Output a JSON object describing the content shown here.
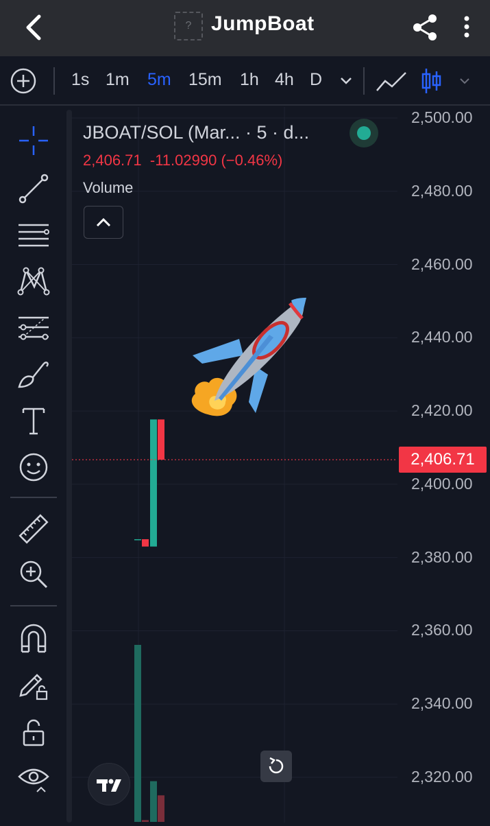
{
  "header": {
    "title": "JumpBoat",
    "image_placeholder": "?"
  },
  "toolbar": {
    "intervals": [
      "1s",
      "1m",
      "5m",
      "15m",
      "1h",
      "4h",
      "D"
    ],
    "active_interval": "5m"
  },
  "legend": {
    "symbol": "JBOAT/SOL (Mar...  · 5 · d...",
    "last": "2,406.71",
    "change": "-11.02990",
    "change_pct": "(−0.46%)",
    "volume_label": "Volume"
  },
  "price_axis": {
    "labels": [
      "2,500.00",
      "2,480.00",
      "2,460.00",
      "2,440.00",
      "2,420.00",
      "2,400.00",
      "2,380.00",
      "2,360.00",
      "2,340.00",
      "2,320.00"
    ],
    "last_price_tag": "2,406.71"
  },
  "colors": {
    "up": "#22ab94",
    "down": "#f23645",
    "accent": "#2962ff",
    "background": "#131722"
  },
  "chart_data": {
    "type": "candlestick",
    "symbol": "JBOAT/SOL",
    "interval": "5m",
    "y_range": [
      2310,
      2505
    ],
    "last_price": 2406.71,
    "candles": [
      {
        "index": 0,
        "open": 2385.0,
        "high": 2385.0,
        "low": 2385.0,
        "close": 2385.0,
        "direction": "flat"
      },
      {
        "index": 1,
        "open": 2385.0,
        "high": 2385.0,
        "low": 2383.0,
        "close": 2383.0,
        "direction": "down"
      },
      {
        "index": 2,
        "open": 2383.0,
        "high": 2417.7,
        "low": 2383.0,
        "close": 2417.7,
        "direction": "up"
      },
      {
        "index": 3,
        "open": 2417.7,
        "high": 2417.7,
        "low": 2406.71,
        "close": 2406.71,
        "direction": "down"
      }
    ],
    "volume": [
      {
        "index": 0,
        "relative": 1.0,
        "direction": "up"
      },
      {
        "index": 1,
        "relative": 0.01,
        "direction": "down"
      },
      {
        "index": 2,
        "relative": 0.23,
        "direction": "up"
      },
      {
        "index": 3,
        "relative": 0.15,
        "direction": "down"
      }
    ],
    "grid": true
  },
  "tools": [
    "crosshair-icon",
    "trend-line-icon",
    "parallel-lines-icon",
    "pattern-icon",
    "fib-icon",
    "brush-icon",
    "text-icon",
    "emoji-icon",
    "ruler-icon",
    "zoom-in-icon",
    "magnet-icon",
    "lock-drawing-icon",
    "lock-icon",
    "eye-icon"
  ]
}
